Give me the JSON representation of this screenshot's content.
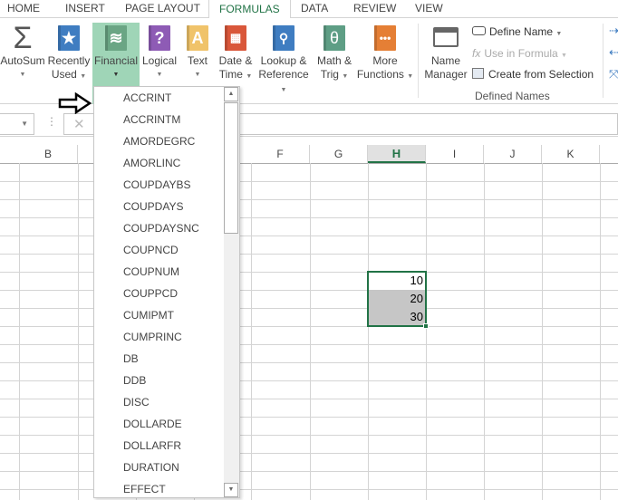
{
  "tabs": [
    "HOME",
    "INSERT",
    "PAGE LAYOUT",
    "FORMULAS",
    "DATA",
    "REVIEW",
    "VIEW"
  ],
  "active_tab": "FORMULAS",
  "ribbon": {
    "autosum": {
      "label": "AutoSum",
      "icon": "sigma-icon"
    },
    "recently_used": {
      "line1": "Recently",
      "line2": "Used",
      "icon": "star-book-icon"
    },
    "financial": {
      "label": "Financial",
      "icon": "coins-book-icon"
    },
    "logical": {
      "label": "Logical",
      "icon": "question-book-icon"
    },
    "text": {
      "label": "Text",
      "icon": "letter-a-book-icon"
    },
    "date_time": {
      "line1": "Date &",
      "line2": "Time",
      "icon": "calendar-book-icon"
    },
    "lookup": {
      "line1": "Lookup &",
      "line2": "Reference",
      "icon": "magnifier-book-icon"
    },
    "math": {
      "line1": "Math &",
      "line2": "Trig",
      "icon": "theta-book-icon"
    },
    "more": {
      "line1": "More",
      "line2": "Functions",
      "icon": "ellipsis-book-icon"
    },
    "name_manager": {
      "line1": "Name",
      "line2": "Manager"
    },
    "define_name": "Define Name",
    "use_in_formula": "Use in Formula",
    "create_from_selection": "Create from Selection",
    "group_label": "Defined Names",
    "colors": {
      "selected": "#9fd5b7",
      "accent": "#217346"
    }
  },
  "formula_bar": {
    "cancel": "✕"
  },
  "columns": [
    "B",
    "F",
    "G",
    "H",
    "I",
    "J",
    "K"
  ],
  "active_column": "H",
  "cells": {
    "H10": "10",
    "H11": "20",
    "H12": "30"
  },
  "financial_menu": [
    "ACCRINT",
    "ACCRINTM",
    "AMORDEGRC",
    "AMORLINC",
    "COUPDAYBS",
    "COUPDAYS",
    "COUPDAYSNC",
    "COUPNCD",
    "COUPNUM",
    "COUPPCD",
    "CUMIPMT",
    "CUMPRINC",
    "DB",
    "DDB",
    "DISC",
    "DOLLARDE",
    "DOLLARFR",
    "DURATION",
    "EFFECT"
  ]
}
